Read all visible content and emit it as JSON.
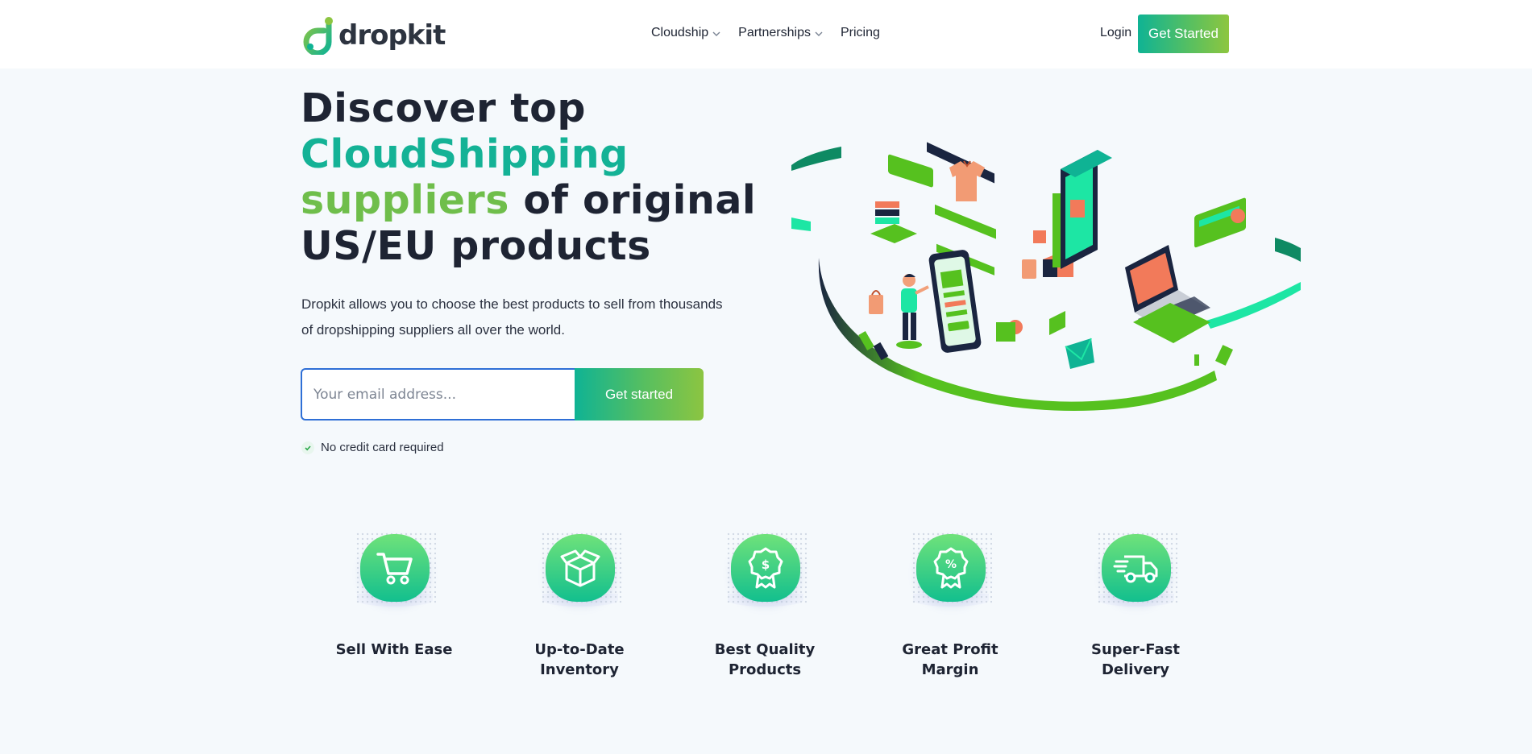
{
  "brand": {
    "name": "dropkit",
    "logo_icon": "dropkit-logo-icon"
  },
  "nav": {
    "items": [
      {
        "label": "Cloudship",
        "has_dropdown": true
      },
      {
        "label": "Partnerships",
        "has_dropdown": true
      },
      {
        "label": "Pricing",
        "has_dropdown": false
      }
    ],
    "login_label": "Login",
    "cta_label": "Get Started"
  },
  "hero": {
    "title_line1": "Discover top",
    "title_highlight1": "CloudShipping",
    "title_highlight2": "suppliers",
    "title_rest": "of original",
    "title_line4": "US/EU products",
    "description": "Dropkit allows you to choose the best products to sell from thousands of dropshipping suppliers all over the world.",
    "email_placeholder": "Your email address...",
    "email_value": "",
    "submit_label": "Get started",
    "note": "No credit card required"
  },
  "features": [
    {
      "icon": "shopping-cart-icon",
      "label": "Sell With Ease"
    },
    {
      "icon": "open-box-icon",
      "label": "Up-to-Date Inventory"
    },
    {
      "icon": "dollar-award-icon",
      "label": "Best Quality Products"
    },
    {
      "icon": "percent-award-icon",
      "label": "Great Profit Margin"
    },
    {
      "icon": "delivery-truck-icon",
      "label": "Super-Fast Delivery"
    }
  ],
  "colors": {
    "brand_teal": "#14b296",
    "brand_green": "#6fbe4b",
    "text_dark": "#1e2433",
    "input_border": "#2f6fd6"
  }
}
